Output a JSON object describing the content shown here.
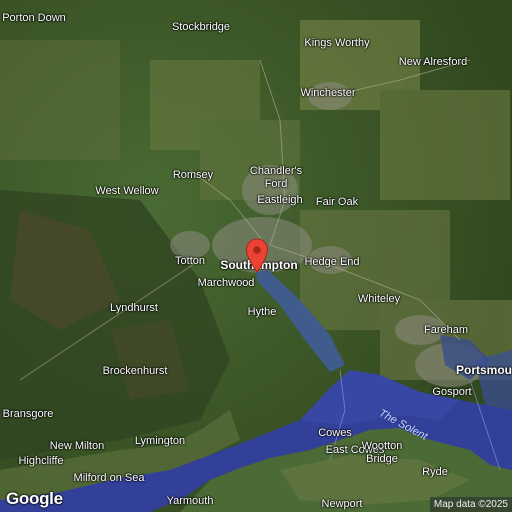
{
  "map": {
    "marker_place": "Southampton",
    "attribution": "Map data ©2025",
    "logo": "Google",
    "labels": {
      "porton_down": "Porton Down",
      "stockbridge": "Stockbridge",
      "kings_worthy": "Kings Worthy",
      "new_alresford": "New Alresford",
      "winchester": "Winchester",
      "romsey": "Romsey",
      "chandlers_ford_1": "Chandler's",
      "chandlers_ford_2": "Ford",
      "west_wellow": "West Wellow",
      "eastleigh": "Eastleigh",
      "fair_oak": "Fair Oak",
      "totton": "Totton",
      "southampton": "Southampton",
      "hedge_end": "Hedge End",
      "marchwood": "Marchwood",
      "lyndhurst": "Lyndhurst",
      "whiteley": "Whiteley",
      "hythe": "Hythe",
      "fareham": "Fareham",
      "brockenhurst": "Brockenhurst",
      "portsmouth": "Portsmou",
      "gosport": "Gosport",
      "bransgore": "Bransgore",
      "the_solent": "The Solent",
      "cowes": "Cowes",
      "lymington": "Lymington",
      "new_milton": "New Milton",
      "east_cowes": "East Cowes",
      "highcliffe": "Highcliffe",
      "wootton_bridge_1": "Wootton",
      "wootton_bridge_2": "Bridge",
      "ryde": "Ryde",
      "milford_on_sea": "Milford on Sea",
      "yarmouth": "Yarmouth",
      "newport": "Newport"
    }
  }
}
